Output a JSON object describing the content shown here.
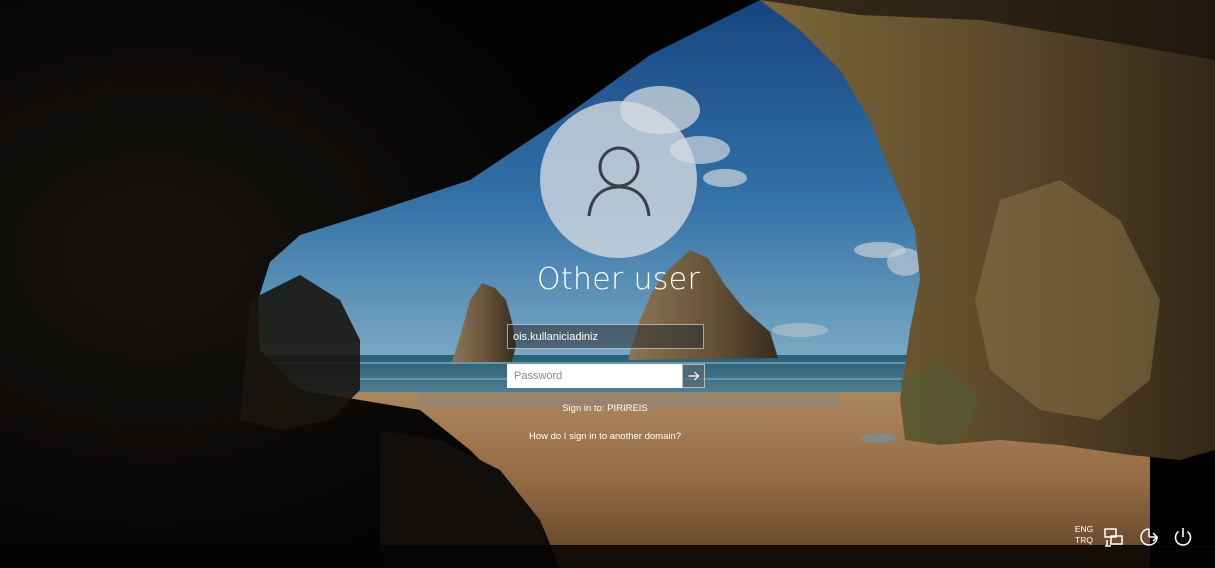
{
  "login": {
    "user_name": "Other user",
    "username_value": "ois.kullaniciadiniz",
    "password_placeholder": "Password",
    "sign_in_to": "Sign in to: PIRIREIS",
    "help_link": "How do I sign in to another domain?"
  },
  "tray": {
    "lang_primary": "ENG",
    "lang_secondary": "TRQ",
    "icons": [
      "network-icon",
      "ease-of-access-icon",
      "power-icon"
    ]
  },
  "colors": {
    "sky_top": "#1f5a9e",
    "sea": "#2c6f8a",
    "sand": "#b6865a",
    "rock": "#2a2118"
  }
}
